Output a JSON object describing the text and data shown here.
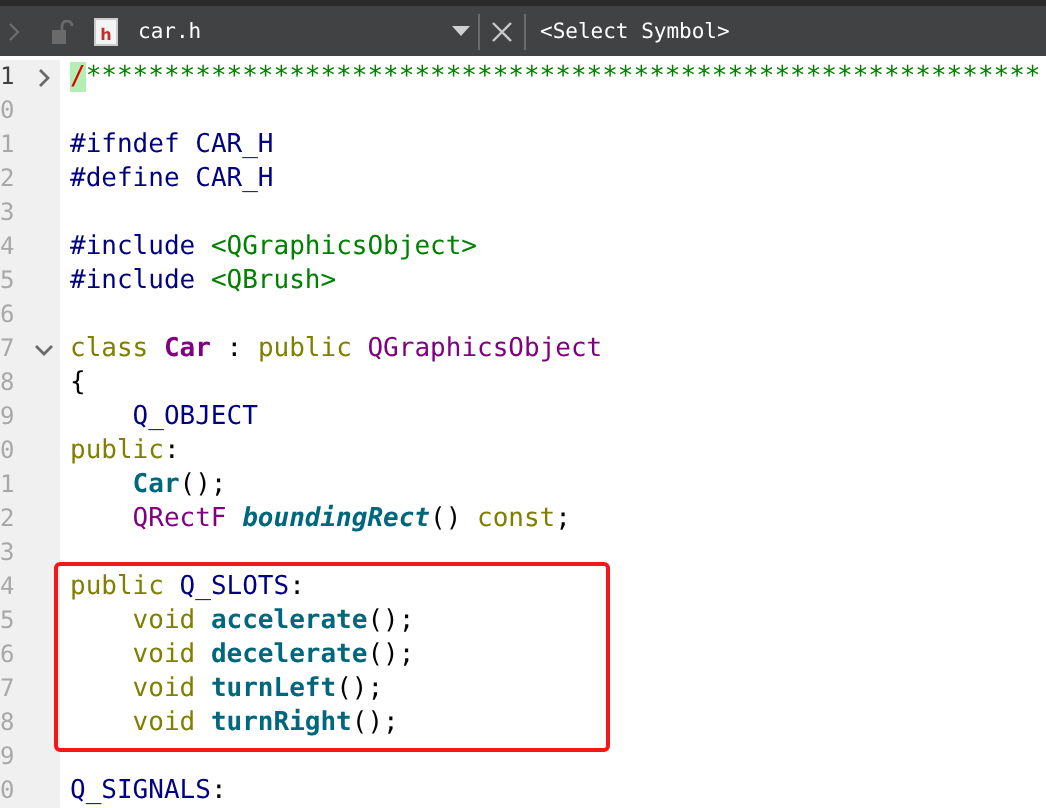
{
  "toolbar": {
    "file_icon_letter": "h",
    "file_name": "car.h",
    "symbol": "<Select Symbol>"
  },
  "lines": [
    {
      "number": "1",
      "current": true,
      "fold_expanded": false,
      "boxed": false,
      "indented": false,
      "tokens": [
        {
          "kind": "match",
          "text": "/"
        },
        {
          "kind": "comment",
          "text": "*************************************************************"
        }
      ]
    },
    {
      "number": "0",
      "current": false,
      "boxed": false
    },
    {
      "number": "1",
      "current": false,
      "boxed": false,
      "indented": false,
      "tokens": [
        {
          "kind": "preproc",
          "text": "#ifndef CAR_H"
        }
      ]
    },
    {
      "number": "2",
      "current": false,
      "boxed": false,
      "indented": false,
      "tokens": [
        {
          "kind": "preproc",
          "text": "#define CAR_H"
        }
      ]
    },
    {
      "number": "3",
      "current": false,
      "boxed": false
    },
    {
      "number": "4",
      "current": false,
      "boxed": false,
      "indented": false,
      "tokens": [
        {
          "kind": "preproc",
          "text": "#include "
        },
        {
          "kind": "string",
          "text": "<QGraphicsObject>"
        }
      ]
    },
    {
      "number": "5",
      "current": false,
      "boxed": false,
      "indented": false,
      "tokens": [
        {
          "kind": "preproc",
          "text": "#include "
        },
        {
          "kind": "string",
          "text": "<QBrush>"
        }
      ]
    },
    {
      "number": "6",
      "current": false,
      "boxed": false
    },
    {
      "number": "7",
      "current": false,
      "fold_expanded": true,
      "boxed": false,
      "indented": false,
      "tokens": [
        {
          "kind": "keyword",
          "text": "class "
        },
        {
          "kind": "classdef",
          "text": "Car"
        },
        {
          "kind": "plain",
          "text": " : "
        },
        {
          "kind": "keyword",
          "text": "public "
        },
        {
          "kind": "type",
          "text": "QGraphicsObject"
        }
      ]
    },
    {
      "number": "8",
      "current": false,
      "boxed": false,
      "indented": false,
      "tokens": [
        {
          "kind": "plain",
          "text": "{"
        }
      ]
    },
    {
      "number": "9",
      "current": false,
      "boxed": false,
      "indented": true,
      "tokens": [
        {
          "kind": "macro",
          "text": "Q_OBJECT"
        }
      ]
    },
    {
      "number": "0",
      "current": false,
      "boxed": false,
      "indented": false,
      "tokens": [
        {
          "kind": "keyword",
          "text": "public"
        },
        {
          "kind": "plain",
          "text": ":"
        }
      ]
    },
    {
      "number": "1",
      "current": false,
      "boxed": false,
      "indented": true,
      "tokens": [
        {
          "kind": "func",
          "text": "Car"
        },
        {
          "kind": "plain",
          "text": "();"
        }
      ]
    },
    {
      "number": "2",
      "current": false,
      "boxed": false,
      "indented": true,
      "tokens": [
        {
          "kind": "type",
          "text": "QRectF "
        },
        {
          "kind": "virtual",
          "text": "boundingRect"
        },
        {
          "kind": "plain",
          "text": "() "
        },
        {
          "kind": "keyword",
          "text": "const"
        },
        {
          "kind": "plain",
          "text": ";"
        }
      ]
    },
    {
      "number": "3",
      "current": false,
      "boxed": false
    },
    {
      "number": "4",
      "current": false,
      "boxed": true,
      "indented": false,
      "tokens": [
        {
          "kind": "keyword",
          "text": "public "
        },
        {
          "kind": "macro",
          "text": "Q_SLOTS"
        },
        {
          "kind": "plain",
          "text": ":"
        }
      ]
    },
    {
      "number": "5",
      "current": false,
      "boxed": true,
      "indented": true,
      "tokens": [
        {
          "kind": "keyword",
          "text": "void "
        },
        {
          "kind": "func",
          "text": "accelerate"
        },
        {
          "kind": "plain",
          "text": "();"
        }
      ]
    },
    {
      "number": "6",
      "current": false,
      "boxed": true,
      "indented": true,
      "tokens": [
        {
          "kind": "keyword",
          "text": "void "
        },
        {
          "kind": "func",
          "text": "decelerate"
        },
        {
          "kind": "plain",
          "text": "();"
        }
      ]
    },
    {
      "number": "7",
      "current": false,
      "boxed": true,
      "indented": true,
      "tokens": [
        {
          "kind": "keyword",
          "text": "void "
        },
        {
          "kind": "func",
          "text": "turnLeft"
        },
        {
          "kind": "plain",
          "text": "();"
        }
      ]
    },
    {
      "number": "8",
      "current": false,
      "boxed": true,
      "indented": true,
      "tokens": [
        {
          "kind": "keyword",
          "text": "void "
        },
        {
          "kind": "func",
          "text": "turnRight"
        },
        {
          "kind": "plain",
          "text": "();"
        }
      ]
    },
    {
      "number": "9",
      "current": false,
      "boxed": false
    },
    {
      "number": "0",
      "current": false,
      "boxed": false,
      "indented": false,
      "tokens": [
        {
          "kind": "macro",
          "text": "Q_SIGNALS"
        },
        {
          "kind": "plain",
          "text": ":"
        }
      ]
    }
  ]
}
